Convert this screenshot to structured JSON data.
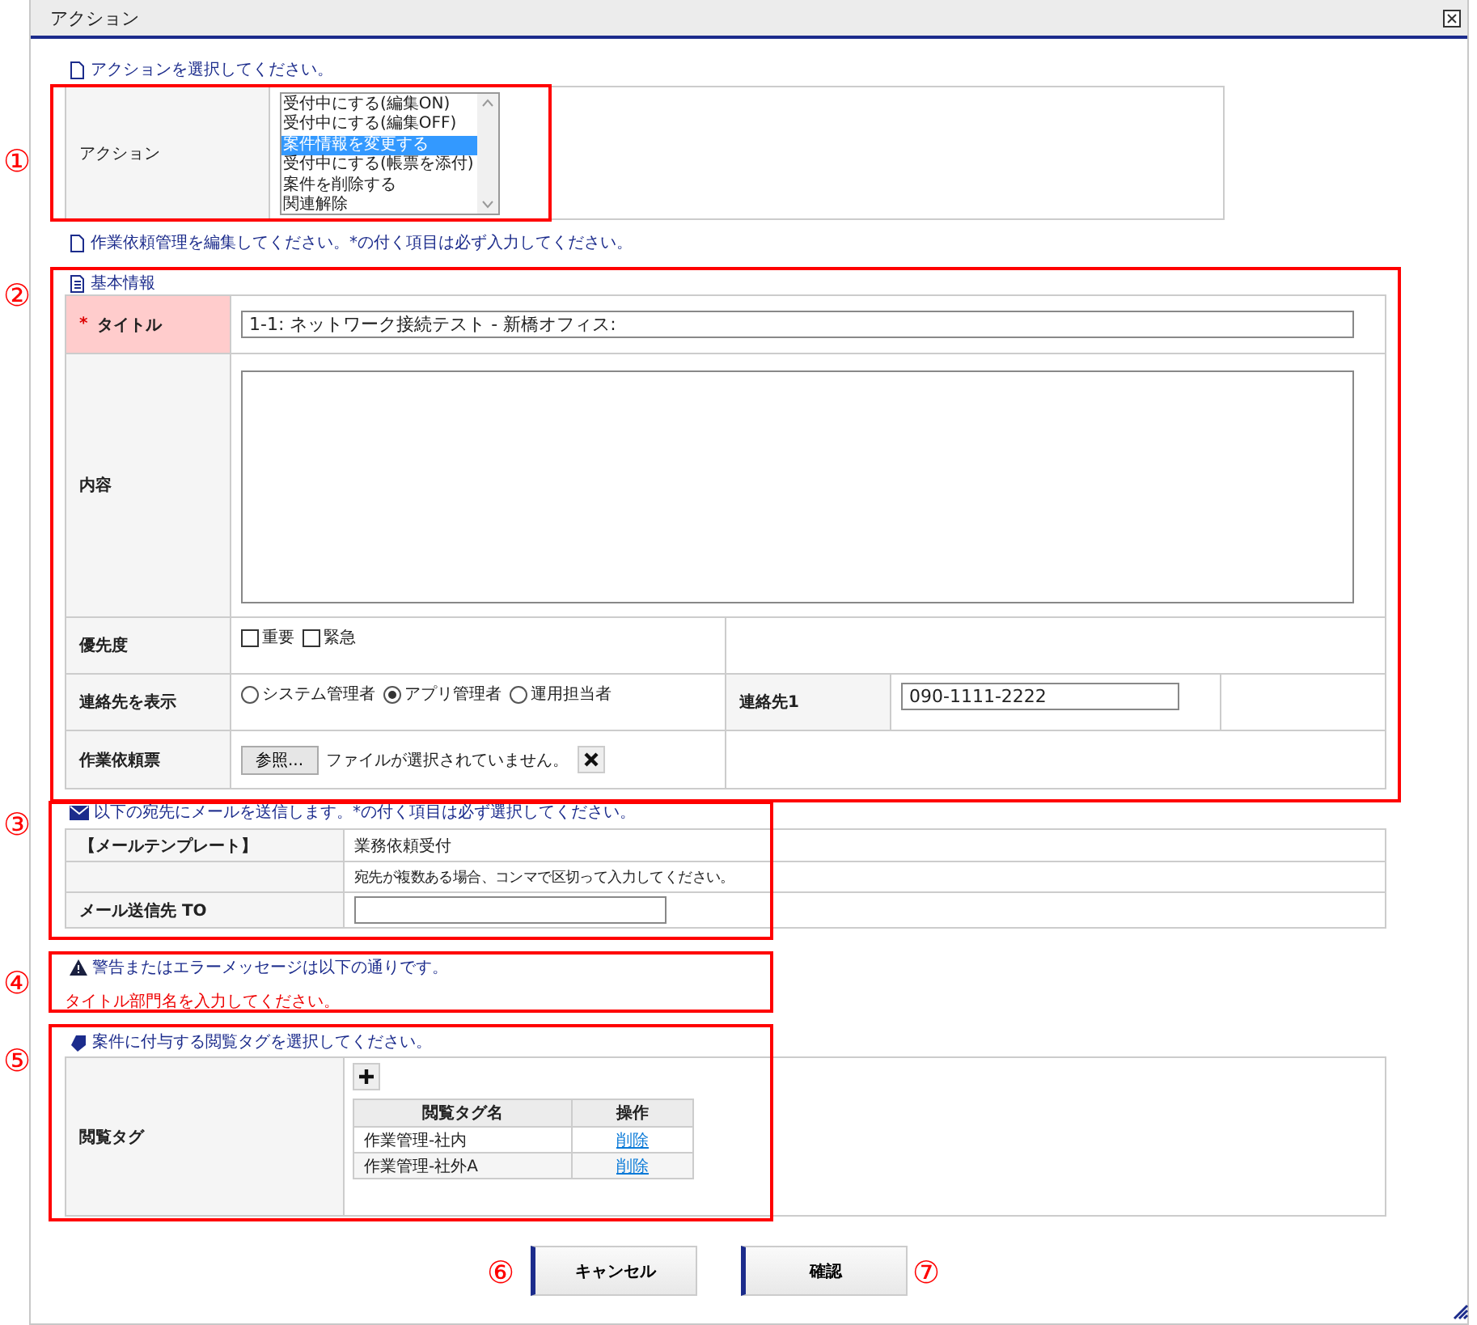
{
  "window": {
    "title": "アクション"
  },
  "action_section": {
    "instruction": "アクションを選択してください。",
    "label": "アクション",
    "options": [
      {
        "label": "受付中にする(編集ON)",
        "selected": false
      },
      {
        "label": "受付中にする(編集OFF)",
        "selected": false
      },
      {
        "label": "案件情報を変更する",
        "selected": true
      },
      {
        "label": "受付中にする(帳票を添付)",
        "selected": false
      },
      {
        "label": "案件を削除する",
        "selected": false
      },
      {
        "label": "関連解除",
        "selected": false
      }
    ]
  },
  "edit_instruction": "作業依頼管理を編集してください。*の付く項目は必ず入力してください。",
  "basic_info": {
    "heading": "基本情報",
    "title": {
      "label": "タイトル",
      "required": true,
      "required_mark": "*",
      "value": "1-1: ネットワーク接続テスト - 新橋オフィス:"
    },
    "content": {
      "label": "内容"
    },
    "priority": {
      "label": "優先度",
      "options": [
        {
          "label": "重要",
          "checked": false
        },
        {
          "label": "緊急",
          "checked": false
        }
      ]
    },
    "contact_display": {
      "label": "連絡先を表示",
      "options": [
        {
          "label": "システム管理者",
          "selected": false
        },
        {
          "label": "アプリ管理者",
          "selected": true
        },
        {
          "label": "運用担当者",
          "selected": false
        }
      ]
    },
    "contact1": {
      "label": "連絡先1",
      "value": "090-1111-2222"
    },
    "attachment": {
      "label": "作業依頼票",
      "button": "参照...",
      "status": "ファイルが選択されていません。"
    }
  },
  "mail": {
    "instruction": "以下の宛先にメールを送信します。*の付く項目は必ず選択してください。",
    "template_label": "【メールテンプレート】",
    "template_value": "業務依頼受付",
    "hint": "宛先が複数ある場合、コンマで区切って入力してください。",
    "to_label": "メール送信先 TO"
  },
  "messages": {
    "heading": "警告またはエラーメッセージは以下の通りです。",
    "errors": [
      "タイトル部門名を入力してください。"
    ]
  },
  "tags": {
    "instruction": "案件に付与する閲覧タグを選択してください。",
    "label": "閲覧タグ",
    "columns": [
      "閲覧タグ名",
      "操作"
    ],
    "rows": [
      {
        "name": "作業管理-社内",
        "action": "削除"
      },
      {
        "name": "作業管理-社外A",
        "action": "削除"
      }
    ]
  },
  "buttons": [
    {
      "label": "キャンセル"
    },
    {
      "label": "確認"
    }
  ],
  "annotations": [
    "①",
    "②",
    "③",
    "④",
    "⑤",
    "⑥",
    "⑦"
  ]
}
